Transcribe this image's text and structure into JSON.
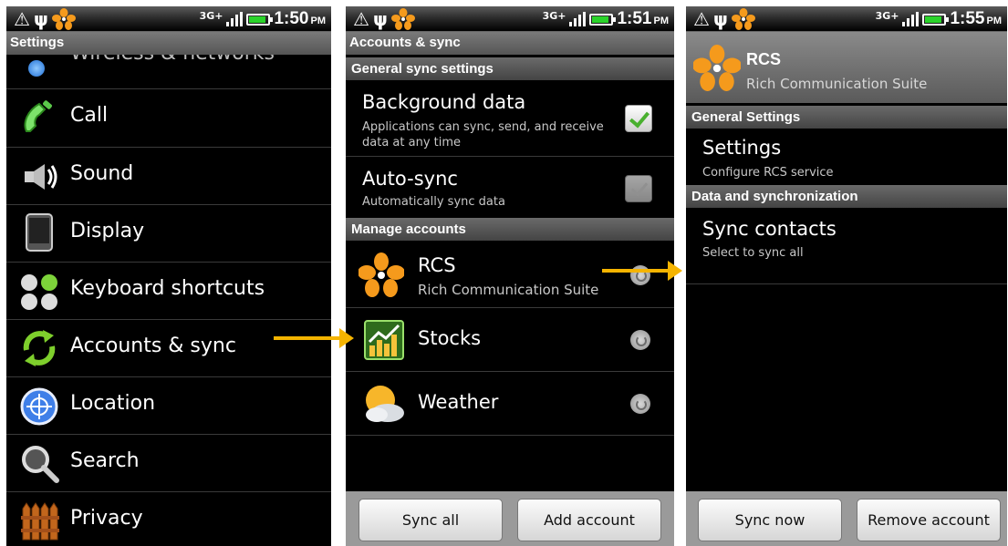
{
  "screens": [
    {
      "status": {
        "network": "3G+",
        "time": "1:50",
        "ampm": "PM"
      },
      "title": "Settings",
      "cut_item": "Wireless & networks",
      "items": [
        {
          "label": "Call",
          "icon": "phone-icon"
        },
        {
          "label": "Sound",
          "icon": "speaker-icon"
        },
        {
          "label": "Display",
          "icon": "display-icon"
        },
        {
          "label": "Keyboard shortcuts",
          "icon": "keyboard-shortcuts-icon"
        },
        {
          "label": "Accounts & sync",
          "icon": "accounts-sync-icon"
        },
        {
          "label": "Location",
          "icon": "location-icon"
        },
        {
          "label": "Search",
          "icon": "search-icon"
        },
        {
          "label": "Privacy",
          "icon": "privacy-icon"
        }
      ]
    },
    {
      "status": {
        "network": "3G+",
        "time": "1:51",
        "ampm": "PM"
      },
      "title": "Accounts & sync",
      "section_general": "General sync settings",
      "background_data": {
        "title": "Background data",
        "subtitle": "Applications can sync, send, and receive data at any time",
        "checked": true
      },
      "auto_sync": {
        "title": "Auto-sync",
        "subtitle": "Automatically sync data",
        "checked": true
      },
      "section_manage": "Manage accounts",
      "accounts": [
        {
          "name": "RCS",
          "subtitle": "Rich Communication Suite",
          "icon": "rcs-icon"
        },
        {
          "name": "Stocks",
          "subtitle": "",
          "icon": "stocks-icon"
        },
        {
          "name": "Weather",
          "subtitle": "",
          "icon": "weather-icon"
        }
      ],
      "buttons": {
        "left": "Sync all",
        "right": "Add account"
      }
    },
    {
      "status": {
        "network": "3G+",
        "time": "1:55",
        "ampm": "PM"
      },
      "header": {
        "title": "RCS",
        "subtitle": "Rich Communication Suite"
      },
      "section_general": "General Settings",
      "settings": {
        "title": "Settings",
        "subtitle": "Configure RCS service"
      },
      "section_data": "Data and synchronization",
      "sync_contacts": {
        "title": "Sync contacts",
        "subtitle": "Select to sync all"
      },
      "buttons": {
        "left": "Sync now",
        "right": "Remove account"
      }
    }
  ],
  "colors": {
    "arrow": "#f5b400",
    "rcs_petal": "#f59a1c",
    "check_green": "#49b02f"
  }
}
